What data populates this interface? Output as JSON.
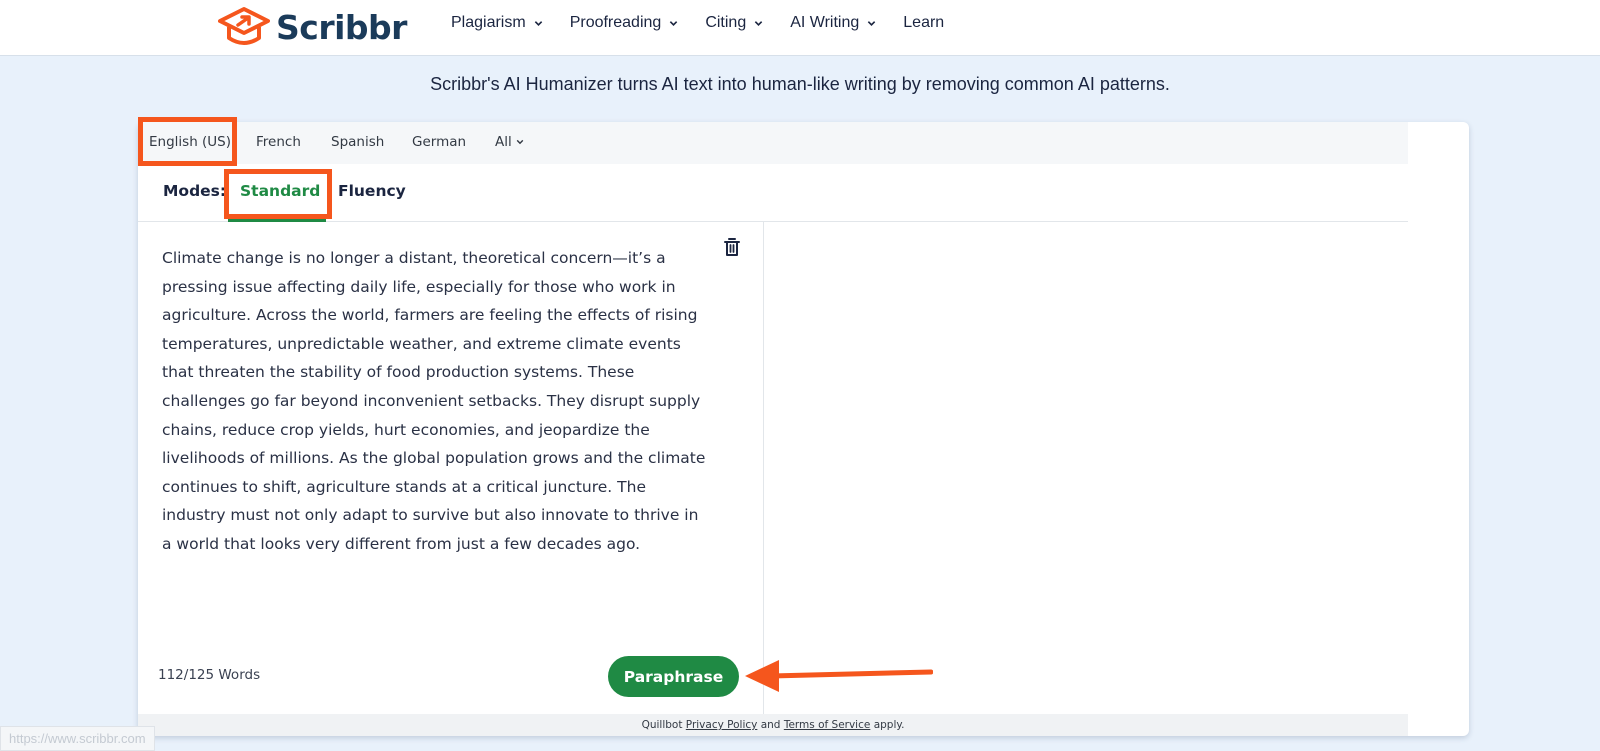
{
  "header": {
    "logo_text": "Scribbr",
    "nav": [
      {
        "label": "Plagiarism",
        "has_dropdown": true
      },
      {
        "label": "Proofreading",
        "has_dropdown": true
      },
      {
        "label": "Citing",
        "has_dropdown": true
      },
      {
        "label": "AI Writing",
        "has_dropdown": true
      },
      {
        "label": "Learn",
        "has_dropdown": false
      }
    ]
  },
  "tagline": "Scribbr's AI Humanizer turns AI text into human-like writing by removing common AI patterns.",
  "tool": {
    "languages": [
      "English (US)",
      "French",
      "Spanish",
      "German",
      "All"
    ],
    "selected_language": "English (US)",
    "modes_label": "Modes:",
    "modes": [
      "Standard",
      "Fluency"
    ],
    "selected_mode": "Standard",
    "input_text": "Climate change is no longer a distant, theoretical concern—it’s a pressing issue affecting daily life, especially for those who work in agriculture. Across the world, farmers are feeling the effects of rising temperatures, unpredictable weather, and extreme climate events that threaten the stability of food production systems. These challenges go far beyond inconvenient setbacks. They disrupt supply chains, reduce crop yields, hurt economies, and jeopardize the livelihoods of millions. As the global population grows and the climate continues to shift, agriculture stands at a critical juncture. The industry must not only adapt to survive but also innovate to thrive in a world that looks very different from just a few decades ago.",
    "word_count": "112/125 Words",
    "paraphrase_label": "Paraphrase",
    "footer": {
      "prefix": "Quillbot",
      "privacy_label": "Privacy Policy",
      "and": "and",
      "terms_label": "Terms of Service",
      "suffix": "apply."
    }
  },
  "status_url": "https://www.scribbr.com",
  "colors": {
    "accent_green": "#1f8a44",
    "highlight_orange": "#f5561d",
    "brand_navy": "#1b3b5a",
    "page_bg": "#e8f1fb"
  }
}
